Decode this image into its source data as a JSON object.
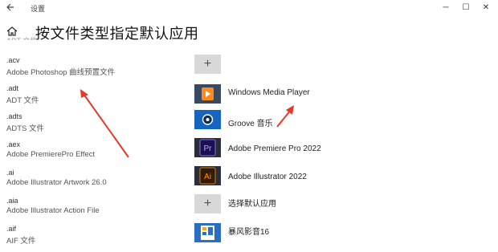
{
  "window": {
    "title": "设置"
  },
  "header": {
    "title": "按文件类型指定默认应用",
    "cut_text": "ADT 文件"
  },
  "rows": [
    {
      "ext": ".acv",
      "desc": "Adobe Photoshop 曲线预置文件",
      "app": "",
      "icon": "plus-icon"
    },
    {
      "ext": ".adt",
      "desc": "ADT 文件",
      "app": "Windows Media Player",
      "icon": "windows-media-player-icon"
    },
    {
      "ext": ".adts",
      "desc": "ADTS 文件",
      "app": "Groove 音乐",
      "icon": "groove-music-icon"
    },
    {
      "ext": ".aex",
      "desc": "Adobe PremierePro Effect",
      "app": "Adobe Premiere Pro 2022",
      "icon": "premiere-pro-icon"
    },
    {
      "ext": ".ai",
      "desc": "Adobe Illustrator Artwork 26.0",
      "app": "Adobe Illustrator 2022",
      "icon": "illustrator-icon"
    },
    {
      "ext": ".aia",
      "desc": "Adobe Illustrator Action File",
      "app": "选择默认应用",
      "icon": "plus-icon"
    },
    {
      "ext": ".aif",
      "desc": "AIF 文件",
      "app": "暴风影音16",
      "icon": "baofeng-icon"
    }
  ],
  "colors": {
    "annotation": "#e53a2a",
    "premiere": "#2b1a5e",
    "illustrator": "#3b1a00",
    "groove": "#1565c0",
    "wmp": "#1e3a6e",
    "baofeng": "#1f6fc4"
  }
}
